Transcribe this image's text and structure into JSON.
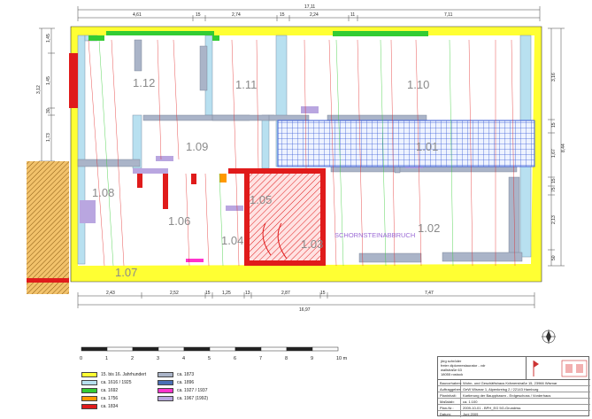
{
  "dimensions": {
    "top_total": "17,11",
    "top_segments": [
      "4,61",
      "15",
      "2,74",
      "15",
      "2,24",
      "11",
      "7,11"
    ],
    "bottom_segments": [
      "2,43",
      "2,52",
      "15",
      "1,25",
      "13",
      "2,87",
      "15",
      "7,47"
    ],
    "bottom_total": "16,97",
    "left_segments": [
      "1,45",
      "3,12",
      "1,45",
      "30",
      "1,73"
    ],
    "right_segments": [
      "3,16",
      "8,44",
      "15",
      "1,67",
      "15",
      "75",
      "2,13",
      "50"
    ]
  },
  "rooms": [
    {
      "id": "1.12"
    },
    {
      "id": "1.11"
    },
    {
      "id": "1.10"
    },
    {
      "id": "1.09"
    },
    {
      "id": "1.01"
    },
    {
      "id": "1.08"
    },
    {
      "id": "1.05"
    },
    {
      "id": "1.06"
    },
    {
      "id": "1.04"
    },
    {
      "id": "1.03"
    },
    {
      "id": "1.02"
    },
    {
      "id": "1.07"
    }
  ],
  "annotation": "SCHORNSTEINABBRUCH",
  "scale_bar": {
    "ticks": [
      "0",
      "1",
      "2",
      "3",
      "4",
      "5",
      "6",
      "7",
      "8",
      "9",
      "10 m"
    ]
  },
  "legend": {
    "items": [
      {
        "label": "15. bis 16. Jahrhundert",
        "color": "#ffff33"
      },
      {
        "label": "ca. 1616 / 1925",
        "color": "#b8e0f0"
      },
      {
        "label": "ca. 1692",
        "color": "#33cc33"
      },
      {
        "label": "ca. 1756",
        "color": "#ff9900"
      },
      {
        "label": "ca. 1834",
        "color": "#e01b1b"
      },
      {
        "label": "ca. 1873",
        "color": "#aab4c8"
      },
      {
        "label": "ca. 1896",
        "color": "#4a6fb5"
      },
      {
        "label": "ca. 1927 / 1937",
        "color": "#ff33cc"
      },
      {
        "label": "ca. 1967 (1992)",
        "color": "#b9a6e0"
      }
    ]
  },
  "title_block": {
    "firm": [
      "jörg schröder",
      "freier diplomrestaurator - vdr",
      "wallstraße 63",
      "18055 rostock"
    ],
    "rows": [
      {
        "key": "Bauvorhaben:",
        "value": "Wohn- und Geschäftshaus Krämerstraße 15, 23966 Wismar"
      },
      {
        "key": "Auftraggeber:",
        "value": "GeW Wismar 1, Alpenkreisg 2 / 22143 Hamburg"
      },
      {
        "key": "Planinhalt:",
        "value": "Kartierung der Baupphasen - Erdgeschoss / Vorderhaus"
      },
      {
        "key": "Maßstab:",
        "value": "ca. 1:100"
      },
      {
        "key": "Plan-Nr.:",
        "value": "2009-10-01 - BPH_EG 5G-Grundriss"
      },
      {
        "key": "Datum:",
        "value": "Juni 2009"
      }
    ]
  }
}
